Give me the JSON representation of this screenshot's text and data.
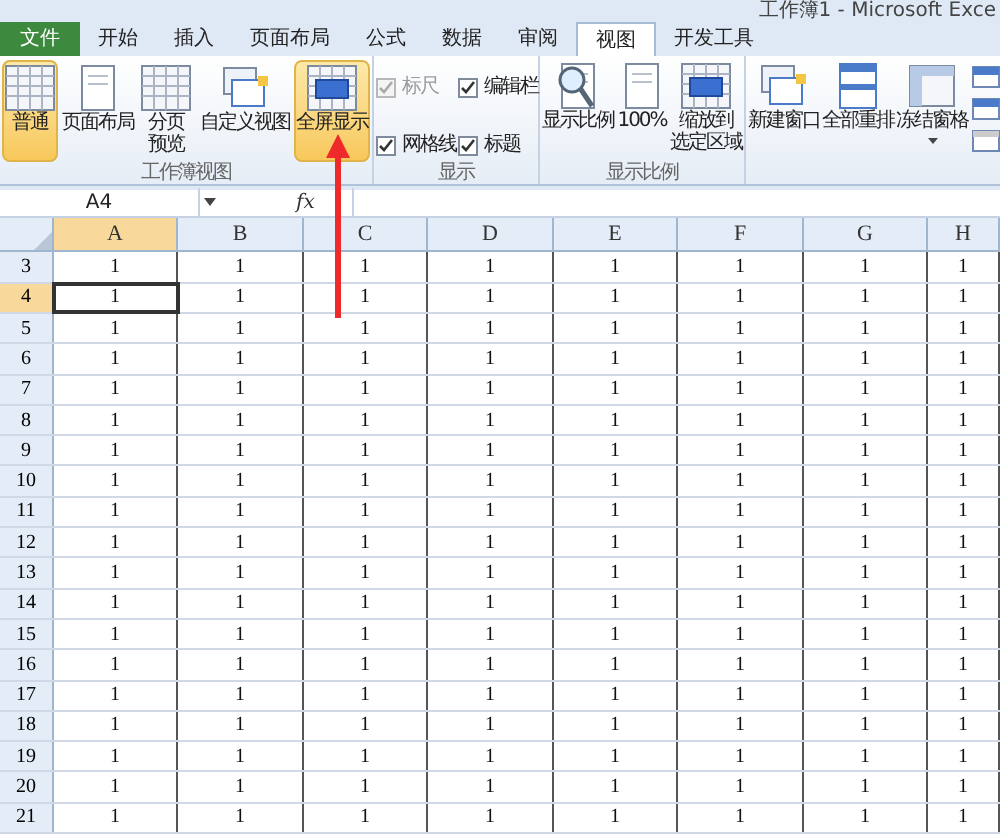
{
  "window": {
    "title": "工作簿1 - Microsoft Exce"
  },
  "tabs": [
    {
      "label": "文件",
      "kind": "file",
      "selected": false
    },
    {
      "label": "开始",
      "kind": "tab",
      "selected": false
    },
    {
      "label": "插入",
      "kind": "tab",
      "selected": false
    },
    {
      "label": "页面布局",
      "kind": "tab",
      "selected": false
    },
    {
      "label": "公式",
      "kind": "tab",
      "selected": false
    },
    {
      "label": "数据",
      "kind": "tab",
      "selected": false
    },
    {
      "label": "审阅",
      "kind": "tab",
      "selected": false
    },
    {
      "label": "视图",
      "kind": "tab",
      "selected": true
    },
    {
      "label": "开发工具",
      "kind": "tab",
      "selected": false
    }
  ],
  "workbook_views": {
    "title": "工作簿视图",
    "buttons": [
      {
        "label": [
          "普通"
        ],
        "highlighted": true
      },
      {
        "label": [
          "页面布局"
        ],
        "highlighted": false
      },
      {
        "label": [
          "分页",
          "预览"
        ],
        "highlighted": false
      },
      {
        "label": [
          "自定义视图"
        ],
        "highlighted": false
      },
      {
        "label": [
          "全屏显示"
        ],
        "highlighted": true
      }
    ]
  },
  "show": {
    "title": "显示",
    "checkboxes": [
      {
        "label": "标尺",
        "checked": true,
        "disabled": true
      },
      {
        "label": "编辑栏",
        "checked": true,
        "disabled": false
      },
      {
        "label": "网格线",
        "checked": true,
        "disabled": false
      },
      {
        "label": "标题",
        "checked": true,
        "disabled": false
      }
    ]
  },
  "zoom": {
    "title": "显示比例",
    "buttons": [
      {
        "label": [
          "显示比例"
        ]
      },
      {
        "label": [
          "100%"
        ]
      },
      {
        "label": [
          "缩放到",
          "选定区域"
        ]
      }
    ]
  },
  "window_group": {
    "buttons": [
      {
        "label": "新建窗口"
      },
      {
        "label": "全部重排"
      },
      {
        "label": "冻结窗格",
        "dropdown": true
      }
    ]
  },
  "formula_bar": {
    "name_box": "A4",
    "fx": "fx"
  },
  "columns": [
    {
      "label": "A",
      "selected": true
    },
    {
      "label": "B",
      "selected": false
    },
    {
      "label": "C",
      "selected": false
    },
    {
      "label": "D",
      "selected": false
    },
    {
      "label": "E",
      "selected": false
    },
    {
      "label": "F",
      "selected": false
    },
    {
      "label": "G",
      "selected": false
    },
    {
      "label": "H",
      "selected": false
    }
  ],
  "rows": [
    {
      "label": "3",
      "selected": false,
      "cells": [
        "1",
        "1",
        "1",
        "1",
        "1",
        "1",
        "1",
        "1"
      ]
    },
    {
      "label": "4",
      "selected": true,
      "cells": [
        "1",
        "1",
        "1",
        "1",
        "1",
        "1",
        "1",
        "1"
      ]
    },
    {
      "label": "5",
      "selected": false,
      "cells": [
        "1",
        "1",
        "1",
        "1",
        "1",
        "1",
        "1",
        "1"
      ]
    },
    {
      "label": "6",
      "selected": false,
      "cells": [
        "1",
        "1",
        "1",
        "1",
        "1",
        "1",
        "1",
        "1"
      ]
    },
    {
      "label": "7",
      "selected": false,
      "cells": [
        "1",
        "1",
        "1",
        "1",
        "1",
        "1",
        "1",
        "1"
      ]
    },
    {
      "label": "8",
      "selected": false,
      "cells": [
        "1",
        "1",
        "1",
        "1",
        "1",
        "1",
        "1",
        "1"
      ]
    },
    {
      "label": "9",
      "selected": false,
      "cells": [
        "1",
        "1",
        "1",
        "1",
        "1",
        "1",
        "1",
        "1"
      ]
    },
    {
      "label": "10",
      "selected": false,
      "cells": [
        "1",
        "1",
        "1",
        "1",
        "1",
        "1",
        "1",
        "1"
      ]
    },
    {
      "label": "11",
      "selected": false,
      "cells": [
        "1",
        "1",
        "1",
        "1",
        "1",
        "1",
        "1",
        "1"
      ]
    },
    {
      "label": "12",
      "selected": false,
      "cells": [
        "1",
        "1",
        "1",
        "1",
        "1",
        "1",
        "1",
        "1"
      ]
    },
    {
      "label": "13",
      "selected": false,
      "cells": [
        "1",
        "1",
        "1",
        "1",
        "1",
        "1",
        "1",
        "1"
      ]
    },
    {
      "label": "14",
      "selected": false,
      "cells": [
        "1",
        "1",
        "1",
        "1",
        "1",
        "1",
        "1",
        "1"
      ]
    },
    {
      "label": "15",
      "selected": false,
      "cells": [
        "1",
        "1",
        "1",
        "1",
        "1",
        "1",
        "1",
        "1"
      ]
    },
    {
      "label": "16",
      "selected": false,
      "cells": [
        "1",
        "1",
        "1",
        "1",
        "1",
        "1",
        "1",
        "1"
      ]
    },
    {
      "label": "17",
      "selected": false,
      "cells": [
        "1",
        "1",
        "1",
        "1",
        "1",
        "1",
        "1",
        "1"
      ]
    },
    {
      "label": "18",
      "selected": false,
      "cells": [
        "1",
        "1",
        "1",
        "1",
        "1",
        "1",
        "1",
        "1"
      ]
    },
    {
      "label": "19",
      "selected": false,
      "cells": [
        "1",
        "1",
        "1",
        "1",
        "1",
        "1",
        "1",
        "1"
      ]
    },
    {
      "label": "20",
      "selected": false,
      "cells": [
        "1",
        "1",
        "1",
        "1",
        "1",
        "1",
        "1",
        "1"
      ]
    },
    {
      "label": "21",
      "selected": false,
      "cells": [
        "1",
        "1",
        "1",
        "1",
        "1",
        "1",
        "1",
        "1"
      ]
    }
  ],
  "annotation": {
    "kind": "arrow"
  }
}
